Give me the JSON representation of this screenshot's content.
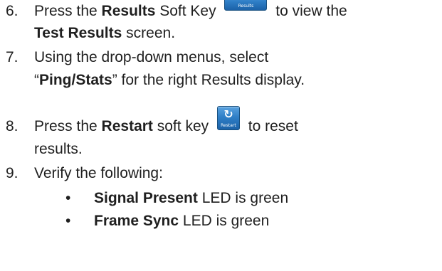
{
  "steps": [
    {
      "number": "6.",
      "line1_bold1": "Results",
      "line1_pre": "Press the ",
      "line1_mid": " Soft Key ",
      "line1_post": " to view the",
      "line2_bold": "Test Results",
      "line2_post": " screen.",
      "softkey_label": "Results"
    },
    {
      "number": "7.",
      "line1": "Using the drop-down menus, select",
      "line2_quote_open": "“",
      "line2_bold": "Ping/Stats",
      "line2_quote_close": "”",
      "line2_post": " for the right Results display."
    },
    {
      "number": "8.",
      "line1_pre": "Press the ",
      "line1_bold": "Restart",
      "line1_mid": " soft key ",
      "line1_post": " to reset",
      "line2": "results.",
      "softkey_label": "Restart",
      "softkey_icon": "↻"
    },
    {
      "number": "9.",
      "line1": "Verify the following:",
      "bullets": [
        {
          "bold": "Signal Present",
          "rest": " LED is green"
        },
        {
          "bold": "Frame Sync",
          "rest": " LED is green"
        }
      ]
    }
  ],
  "bullet_symbol": "•"
}
